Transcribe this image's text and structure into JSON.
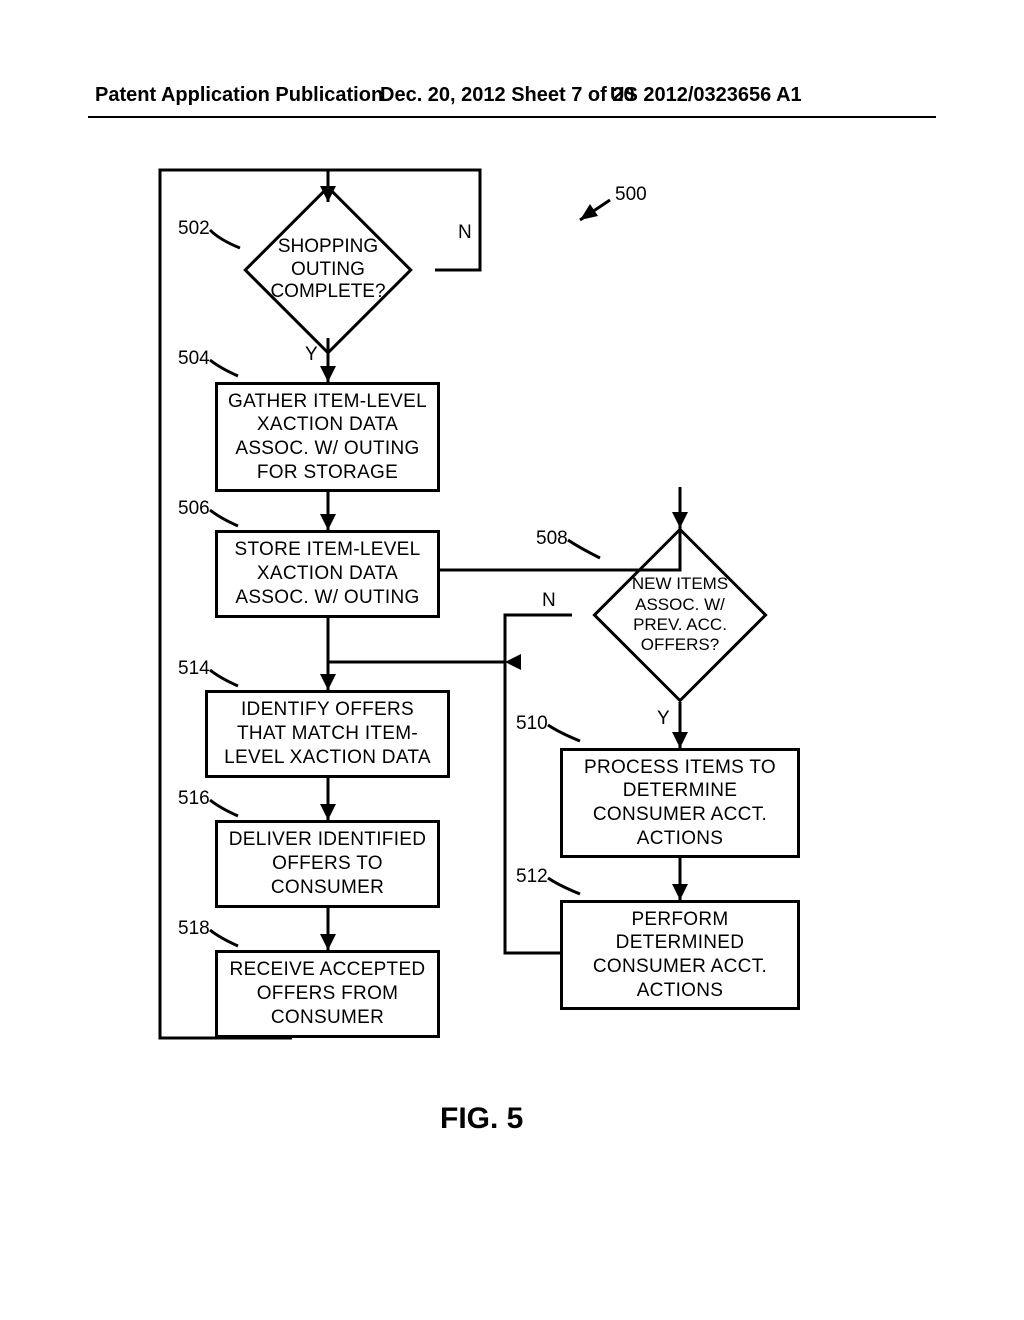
{
  "header": {
    "left": "Patent Application Publication",
    "mid": "Dec. 20, 2012  Sheet 7 of 20",
    "right": "US 2012/0323656 A1"
  },
  "figure_ref": "500",
  "figure_caption": "FIG. 5",
  "refs": {
    "r502": "502",
    "r504": "504",
    "r506": "506",
    "r508": "508",
    "r510": "510",
    "r512": "512",
    "r514": "514",
    "r516": "516",
    "r518": "518"
  },
  "nodes": {
    "d502": "SHOPPING\nOUTING\nCOMPLETE?",
    "b504": "GATHER ITEM-LEVEL\nXACTION DATA\nASSOC. W/ OUTING\nFOR STORAGE",
    "b506": "STORE ITEM-LEVEL\nXACTION DATA\nASSOC. W/ OUTING",
    "d508": "NEW ITEMS\nASSOC. W/\nPREV. ACC.\nOFFERS?",
    "b510": "PROCESS ITEMS TO\nDETERMINE\nCONSUMER ACCT.\nACTIONS",
    "b512": "PERFORM\nDETERMINED\nCONSUMER ACCT.\nACTIONS",
    "b514": "IDENTIFY OFFERS\nTHAT MATCH ITEM-\nLEVEL XACTION DATA",
    "b516": "DELIVER IDENTIFIED\nOFFERS TO\nCONSUMER",
    "b518": "RECEIVE ACCEPTED\nOFFERS FROM\nCONSUMER"
  },
  "edges": {
    "Y": "Y",
    "N": "N"
  },
  "chart_data": {
    "type": "flowchart",
    "title": "FIG. 5",
    "figure_number": "500",
    "nodes": [
      {
        "id": "502",
        "type": "decision",
        "text": "SHOPPING OUTING COMPLETE?"
      },
      {
        "id": "504",
        "type": "process",
        "text": "GATHER ITEM-LEVEL XACTION DATA ASSOC. W/ OUTING FOR STORAGE"
      },
      {
        "id": "506",
        "type": "process",
        "text": "STORE ITEM-LEVEL XACTION DATA ASSOC. W/ OUTING"
      },
      {
        "id": "508",
        "type": "decision",
        "text": "NEW ITEMS ASSOC. W/ PREV. ACC. OFFERS?"
      },
      {
        "id": "510",
        "type": "process",
        "text": "PROCESS ITEMS TO DETERMINE CONSUMER ACCT. ACTIONS"
      },
      {
        "id": "512",
        "type": "process",
        "text": "PERFORM DETERMINED CONSUMER ACCT. ACTIONS"
      },
      {
        "id": "514",
        "type": "process",
        "text": "IDENTIFY OFFERS THAT MATCH ITEM-LEVEL XACTION DATA"
      },
      {
        "id": "516",
        "type": "process",
        "text": "DELIVER IDENTIFIED OFFERS TO CONSUMER"
      },
      {
        "id": "518",
        "type": "process",
        "text": "RECEIVE ACCEPTED OFFERS FROM CONSUMER"
      }
    ],
    "edges": [
      {
        "from": "start_loop",
        "to": "502"
      },
      {
        "from": "502",
        "to": "504",
        "label": "Y"
      },
      {
        "from": "502",
        "to": "start_loop",
        "label": "N",
        "loopback": true
      },
      {
        "from": "504",
        "to": "506"
      },
      {
        "from": "506",
        "to": "508"
      },
      {
        "from": "508",
        "to": "510",
        "label": "Y"
      },
      {
        "from": "508",
        "to": "506",
        "label": "N",
        "loopback": true
      },
      {
        "from": "510",
        "to": "512"
      },
      {
        "from": "512",
        "to": "506",
        "loopback": true
      },
      {
        "from": "506",
        "to": "514"
      },
      {
        "from": "514",
        "to": "516"
      },
      {
        "from": "516",
        "to": "518"
      },
      {
        "from": "518",
        "to": "start_loop",
        "loopback": true
      }
    ]
  }
}
